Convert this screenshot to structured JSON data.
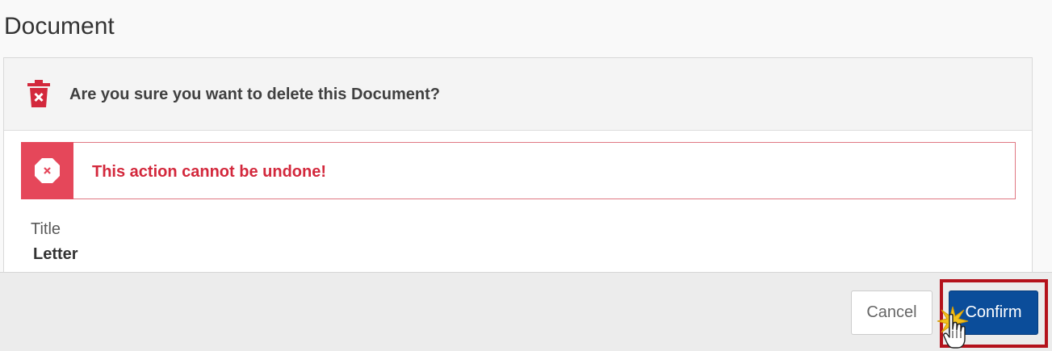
{
  "page": {
    "title": "Document"
  },
  "dialog": {
    "question": "Are you sure you want to delete this Document?",
    "header_icon": "trash-delete-icon",
    "alert": {
      "icon": "octagon-x-icon",
      "message": "This action cannot be undone!"
    },
    "field": {
      "label": "Title",
      "value": "Letter"
    }
  },
  "footer": {
    "cancel_label": "Cancel",
    "confirm_label": "Confirm"
  },
  "colors": {
    "danger": "#e5475a",
    "danger_text": "#d3283c",
    "primary": "#0b4d9a",
    "highlight": "#b4121b"
  }
}
